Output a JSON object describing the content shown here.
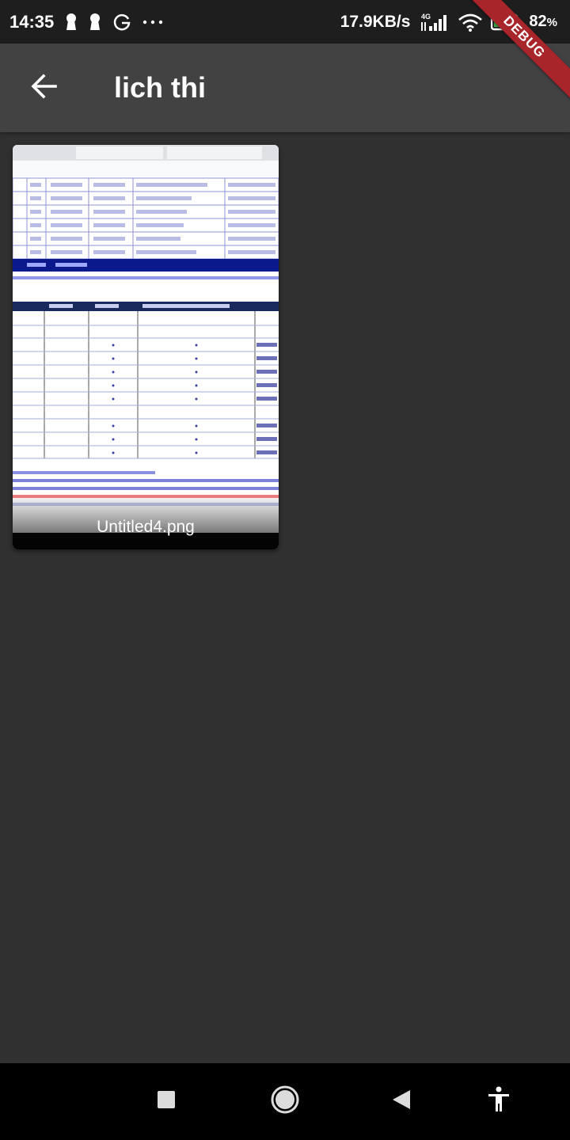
{
  "status_bar": {
    "time": "14:35",
    "net_speed": "17.9KB/s",
    "network_type": "4G",
    "battery_percent": "82",
    "battery_unit": "%",
    "icons": [
      "keyhole-icon",
      "keyhole-icon",
      "g-icon",
      "more-dots-icon",
      "signal-icon",
      "wifi-icon",
      "battery-icon"
    ]
  },
  "debug_banner": "DEBUG",
  "app_bar": {
    "title": "lich thi",
    "back_icon": "arrow-back-icon"
  },
  "files": [
    {
      "name": "Untitled4.png",
      "thumbnail": "spreadsheet-screenshot"
    }
  ],
  "nav_bar": {
    "icons": [
      "square-recents-icon",
      "circle-home-icon",
      "triangle-back-icon",
      "accessibility-icon"
    ]
  },
  "colors": {
    "background": "#303030",
    "app_bar": "#424242",
    "status_bar": "#1e1e1e",
    "debug_ribbon": "#a8252a"
  }
}
